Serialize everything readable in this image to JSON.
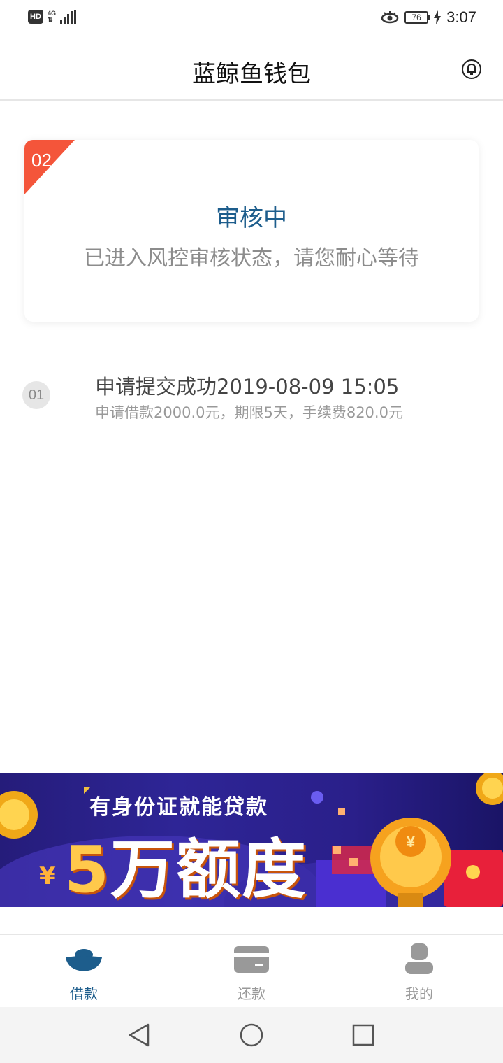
{
  "status_bar": {
    "hd": "HD",
    "network": "4G",
    "battery": "76",
    "time": "3:07"
  },
  "header": {
    "title": "蓝鲸鱼钱包",
    "bell_icon": "bell-icon"
  },
  "status_card": {
    "step": "02",
    "title": "审核中",
    "description": "已进入风控审核状态，请您耐心等待"
  },
  "steps": [
    {
      "number": "01",
      "title": "申请提交成功2019-08-09 15:05",
      "detail": "申请借款2000.0元，期限5天，手续费820.0元"
    }
  ],
  "banner": {
    "line1": "有身份证就能贷款",
    "yen": "¥",
    "amount": "5",
    "line2_rest": "万额度"
  },
  "tabbar": {
    "items": [
      {
        "label": "借款",
        "icon": "ingot-icon",
        "active": true
      },
      {
        "label": "还款",
        "icon": "card-icon",
        "active": false
      },
      {
        "label": "我的",
        "icon": "user-icon",
        "active": false
      }
    ]
  },
  "colors": {
    "primary": "#1d5d8c",
    "accent": "#f4553a",
    "muted": "#999999"
  }
}
